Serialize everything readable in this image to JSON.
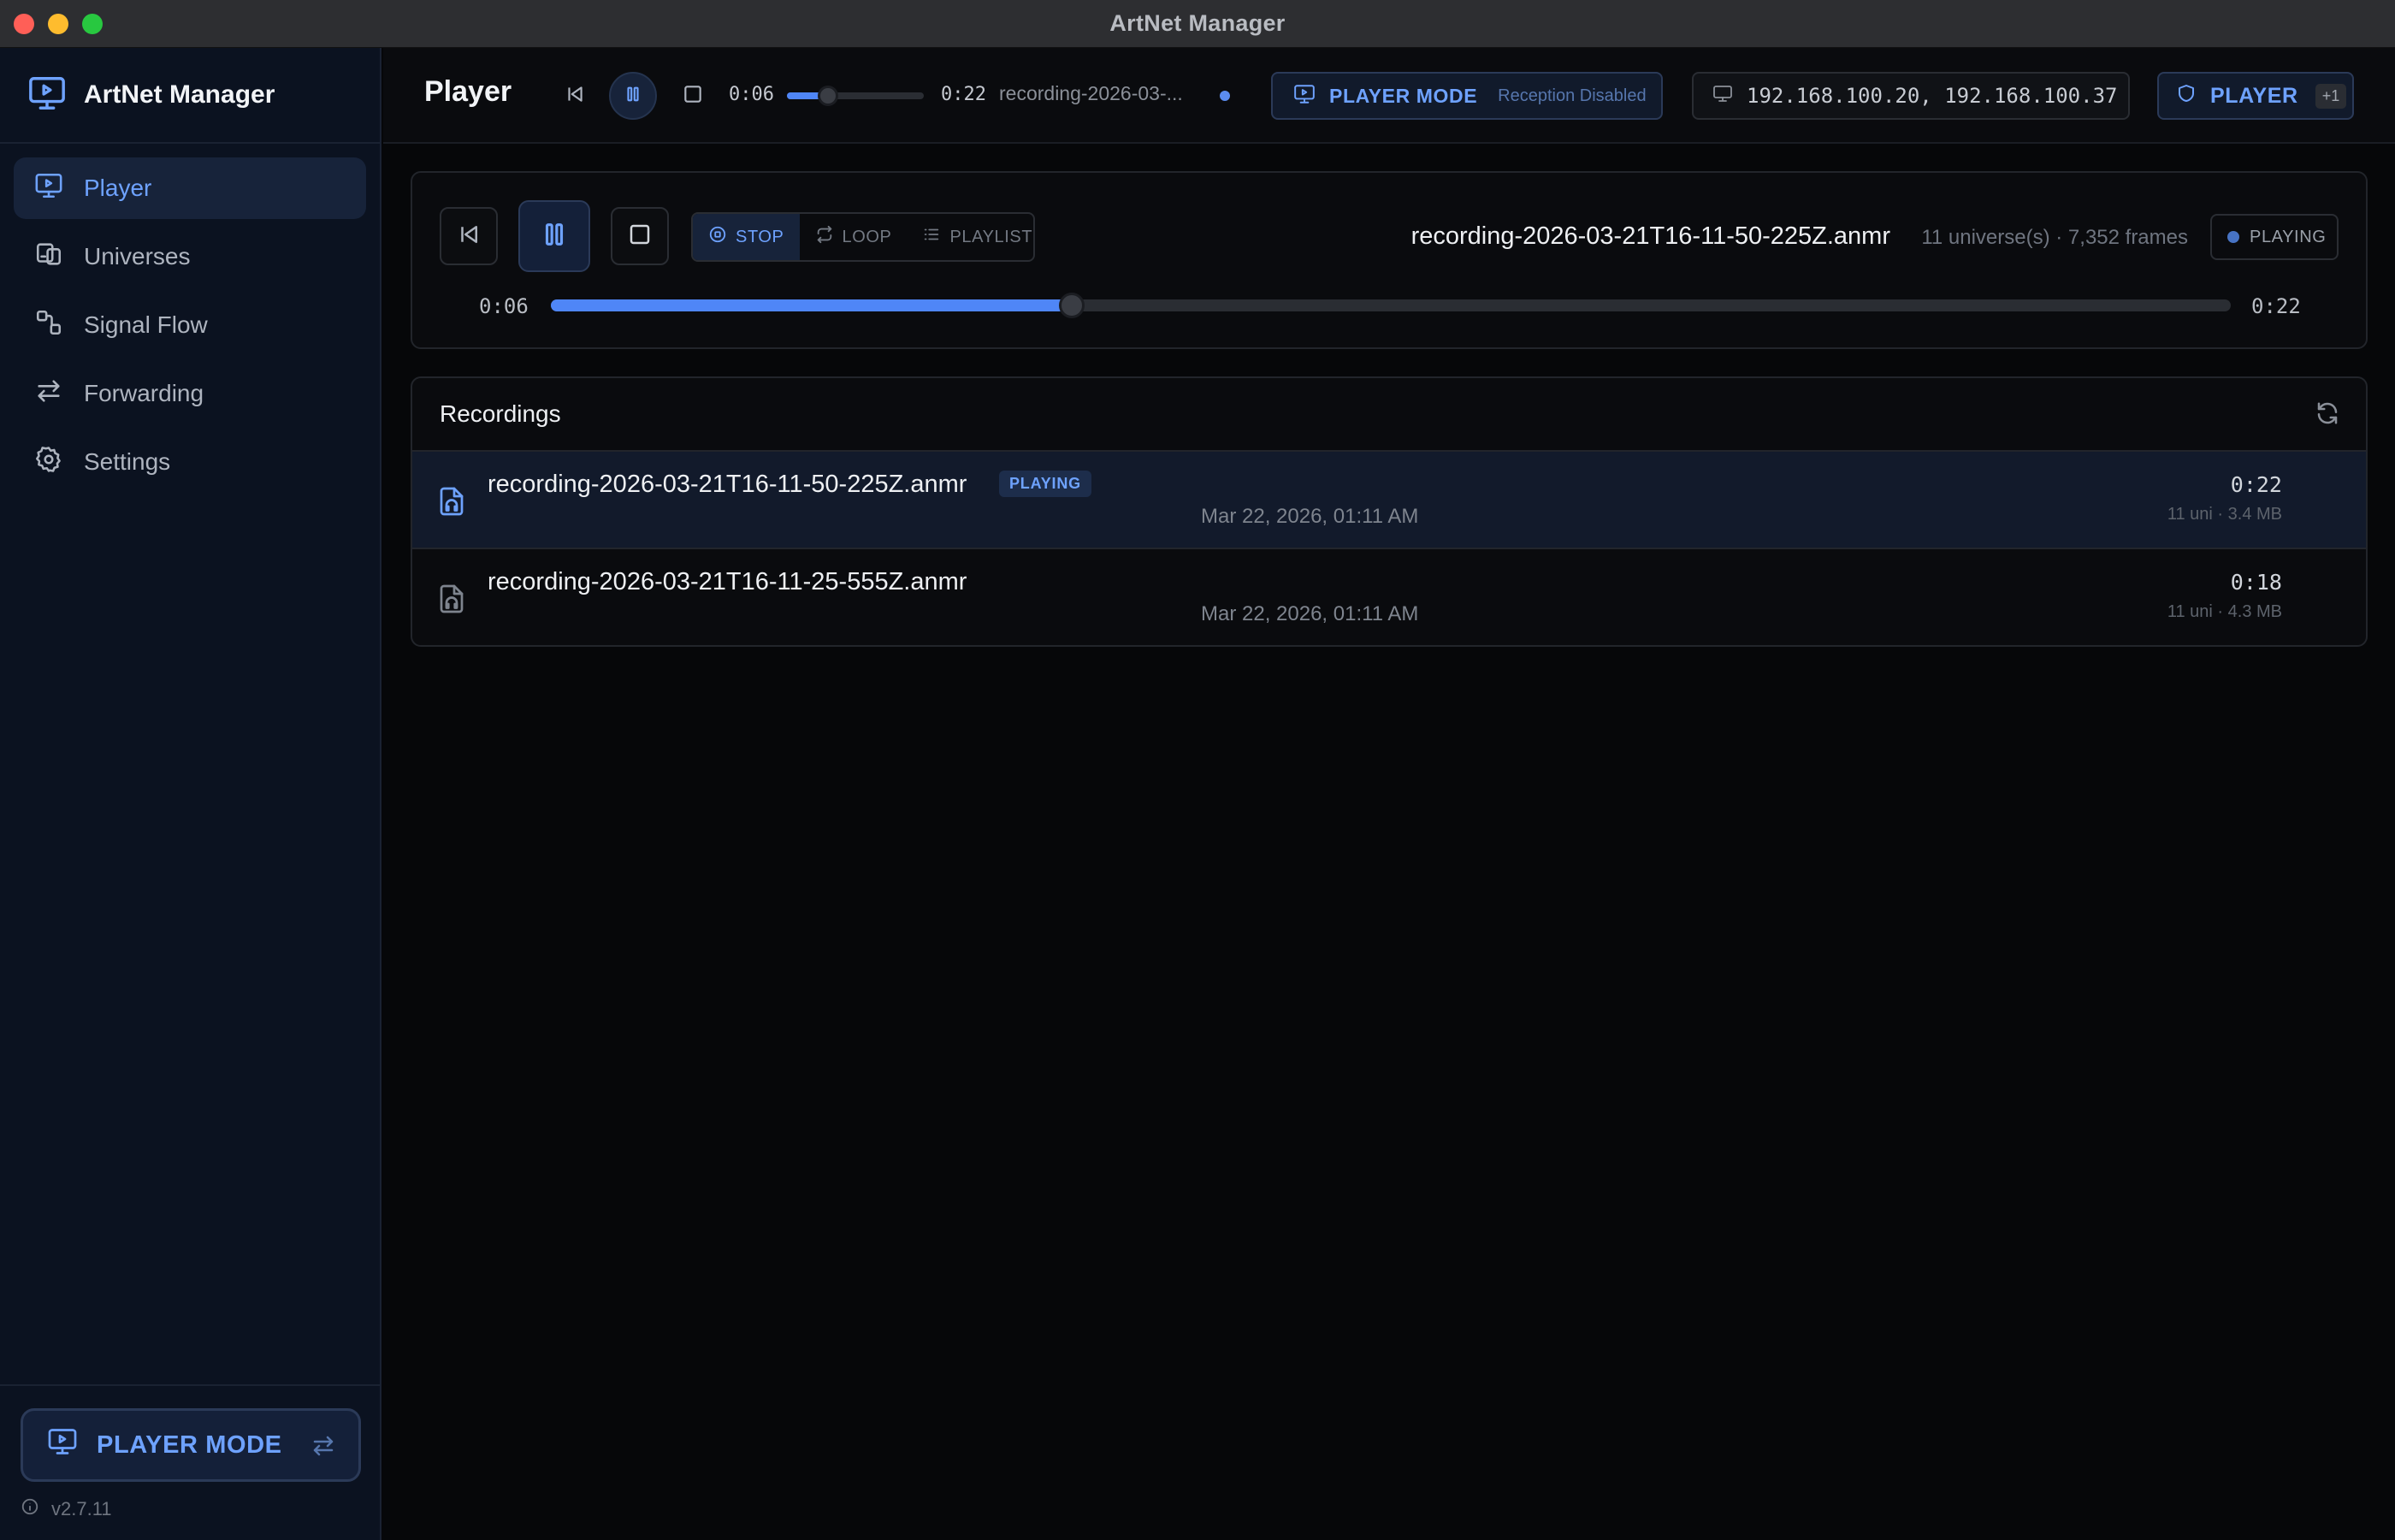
{
  "window": {
    "title": "ArtNet Manager"
  },
  "sidebar": {
    "app_name": "ArtNet Manager",
    "items": [
      {
        "label": "Player",
        "icon": "monitor-play-icon",
        "active": true
      },
      {
        "label": "Universes",
        "icon": "devices-icon",
        "active": false
      },
      {
        "label": "Signal Flow",
        "icon": "signal-flow-icon",
        "active": false
      },
      {
        "label": "Forwarding",
        "icon": "arrows-exchange-icon",
        "active": false
      },
      {
        "label": "Settings",
        "icon": "gear-icon",
        "active": false
      }
    ],
    "mode_button_label": "PLAYER MODE",
    "version": "v2.7.11"
  },
  "topbar": {
    "page_title": "Player",
    "elapsed": "0:06",
    "total": "0:22",
    "progress": 0.3,
    "file_short": "recording-2026-03-...",
    "mode_label": "PLAYER MODE",
    "mode_sub": "Reception Disabled",
    "ips": "192.168.100.20, 192.168.100.37",
    "role_label": "PLAYER",
    "role_badge": "+1"
  },
  "player": {
    "modes": [
      {
        "label": "STOP",
        "active": true
      },
      {
        "label": "LOOP",
        "active": false
      },
      {
        "label": "PLAYLIST",
        "active": false
      }
    ],
    "file": "recording-2026-03-21T16-11-50-225Z.anmr",
    "meta": "11 universe(s) · 7,352 frames",
    "status": "PLAYING",
    "elapsed": "0:06",
    "total": "0:22",
    "progress": 0.31
  },
  "recordings": {
    "title": "Recordings",
    "rows": [
      {
        "name": "recording-2026-03-21T16-11-50-225Z.anmr",
        "tag": "PLAYING",
        "date": "Mar 22, 2026, 01:11 AM",
        "duration": "0:22",
        "info": "11 uni · 3.4 MB",
        "selected": true
      },
      {
        "name": "recording-2026-03-21T16-11-25-555Z.anmr",
        "tag": "",
        "date": "Mar 22, 2026, 01:11 AM",
        "duration": "0:18",
        "info": "11 uni · 4.3 MB",
        "selected": false
      }
    ]
  },
  "colors": {
    "accent": "#4f86f7",
    "accent_text": "#6ea2ff",
    "sidebar_bg": "#0b1220",
    "app_bg": "#0a0b0e"
  }
}
